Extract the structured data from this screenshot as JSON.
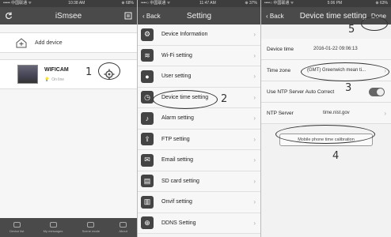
{
  "panel1": {
    "status": {
      "left": "••••• 中国联通 ᯤ",
      "time": "10:38 AM",
      "right": "⊕ 68%"
    },
    "title": "iSmsee",
    "add_device": "Add device",
    "camera": {
      "name": "WIFICAM",
      "status": "On line"
    },
    "tabs": [
      "Device list",
      "My messages",
      "Scene mode",
      "About"
    ]
  },
  "panel2": {
    "status": {
      "left": "••••○ 中国联通 ᯤ",
      "time": "11:47 AM",
      "right": "⊕ 37%"
    },
    "back": "Back",
    "title": "Setting",
    "items": [
      {
        "label": "Device Information",
        "icon": "gear-icon",
        "glyph": "⚙"
      },
      {
        "label": "Wi-Fi setting",
        "icon": "wifi-icon",
        "glyph": "≋"
      },
      {
        "label": "User setting",
        "icon": "user-icon",
        "glyph": "●"
      },
      {
        "label": "Device time setting",
        "icon": "clock-icon",
        "glyph": "◷"
      },
      {
        "label": "Alarm setting",
        "icon": "bell-icon",
        "glyph": "♪"
      },
      {
        "label": "FTP setting",
        "icon": "upload-icon",
        "glyph": "⇪"
      },
      {
        "label": "Email setting",
        "icon": "mail-icon",
        "glyph": "✉"
      },
      {
        "label": "SD card setting",
        "icon": "sdcard-icon",
        "glyph": "▤"
      },
      {
        "label": "Onvif setting",
        "icon": "onvif-icon",
        "glyph": "▥"
      },
      {
        "label": "DDNS Setting",
        "icon": "globe-icon",
        "glyph": "⊕"
      }
    ]
  },
  "panel3": {
    "status": {
      "left": "••••○ 中国联通 ᯤ",
      "time": "5:06 PM",
      "right": "⊕ 63%"
    },
    "back": "Back",
    "title": "Device time setting",
    "done": "Done",
    "device_time_label": "Device time",
    "device_time_value": "2016-01-22 09:06:13",
    "time_zone_label": "Time zone",
    "time_zone_value": "(GMT) Greenwich mean ti...",
    "ntp_auto_label": "Use NTP Server Auto Correct",
    "ntp_server_label": "NTP Server",
    "ntp_server_value": "time.nist.gov",
    "calibration_button": "Mobile phone time calibration"
  },
  "annotations": [
    "1",
    "2",
    "3",
    "4",
    "5"
  ]
}
